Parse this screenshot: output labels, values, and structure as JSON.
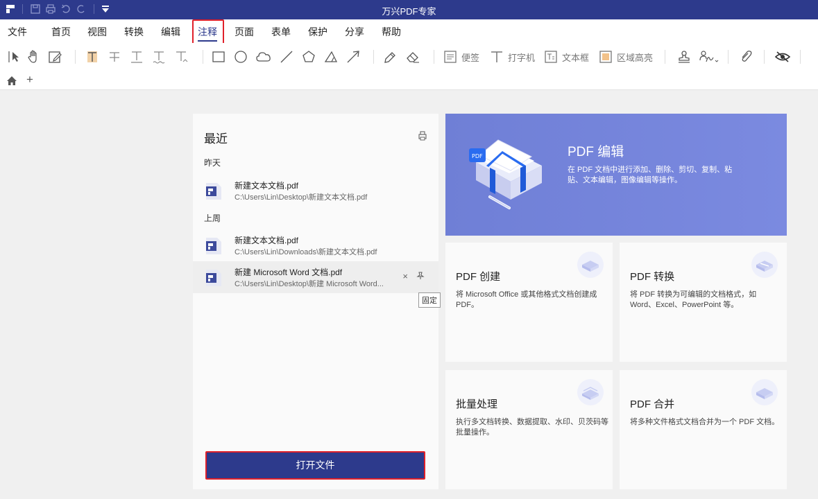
{
  "window": {
    "title": "万兴PDF专家"
  },
  "menu": {
    "items": [
      {
        "label": "文件",
        "active": false
      },
      {
        "label": "首页",
        "active": false
      },
      {
        "label": "视图",
        "active": false
      },
      {
        "label": "转换",
        "active": false
      },
      {
        "label": "编辑",
        "active": false
      },
      {
        "label": "注释",
        "active": true
      },
      {
        "label": "页面",
        "active": false
      },
      {
        "label": "表单",
        "active": false
      },
      {
        "label": "保护",
        "active": false
      },
      {
        "label": "分享",
        "active": false
      },
      {
        "label": "帮助",
        "active": false
      }
    ]
  },
  "toolbar": {
    "note_label": "便签",
    "typewriter_label": "打字机",
    "textbox_label": "文本框",
    "area_highlight_label": "区域高亮"
  },
  "recent": {
    "title": "最近",
    "groups": [
      {
        "label": "昨天",
        "files": [
          {
            "name": "新建文本文档.pdf",
            "path": "C:\\Users\\Lin\\Desktop\\新建文本文档.pdf"
          }
        ]
      },
      {
        "label": "上周",
        "files": [
          {
            "name": "新建文本文档.pdf",
            "path": "C:\\Users\\Lin\\Downloads\\新建文本文档.pdf"
          },
          {
            "name": "新建 Microsoft Word 文档.pdf",
            "path": "C:\\Users\\Lin\\Desktop\\新建 Microsoft Word..."
          }
        ]
      }
    ],
    "remove_glyph": "×",
    "pin_tooltip": "固定",
    "open_button": "打开文件"
  },
  "hero": {
    "title": "PDF 编辑",
    "description": "在 PDF 文档中进行添加、删除、剪切、复制、粘贴、文本编辑，图像编辑等操作。"
  },
  "cards": [
    {
      "title": "PDF 创建",
      "description": "将 Microsoft Office 或其他格式文档创建成PDF。"
    },
    {
      "title": "PDF 转换",
      "description": "将 PDF 转换为可编辑的文档格式，如 Word、Excel、PowerPoint 等。"
    },
    {
      "title": "批量处理",
      "description": "执行多文档转换、数据提取、水印、贝茨码等批量操作。"
    },
    {
      "title": "PDF 合并",
      "description": "将多种文件格式文档合并为一个 PDF 文档。"
    }
  ],
  "colors": {
    "brand": "#2d3a8c",
    "hero": "#7382dc",
    "highlight": "#e0202a"
  }
}
